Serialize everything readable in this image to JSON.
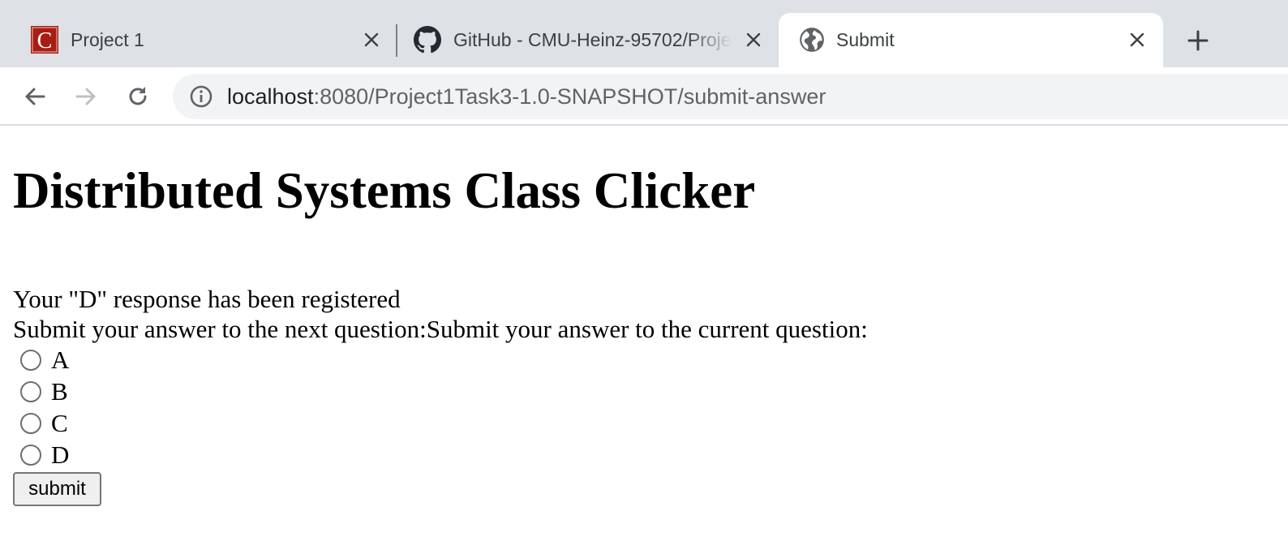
{
  "browser": {
    "tabs": [
      {
        "title": "Project 1",
        "favicon": "letter-c-favicon",
        "favicon_letter": "C",
        "active": false
      },
      {
        "title": "GitHub - CMU-Heinz-95702/Project-1",
        "favicon": "github-icon",
        "active": false
      },
      {
        "title": "Submit",
        "favicon": "globe-icon",
        "active": true
      }
    ],
    "close_glyph": "×",
    "new_tab_glyph": "+",
    "url_host": "localhost",
    "url_rest": ":8080/Project1Task3-1.0-SNAPSHOT/submit-answer",
    "colors": {
      "tabstrip": "#dee1e6",
      "omnibox": "#f1f3f4",
      "favicon_red": "#a81d12"
    }
  },
  "page": {
    "heading": "Distributed Systems Class Clicker",
    "response_message": "Your \"D\" response has been registered",
    "prompt": "Submit your answer to the next question:Submit your answer to the current question:",
    "options": [
      "A",
      "B",
      "C",
      "D"
    ],
    "submit_label": "submit"
  }
}
